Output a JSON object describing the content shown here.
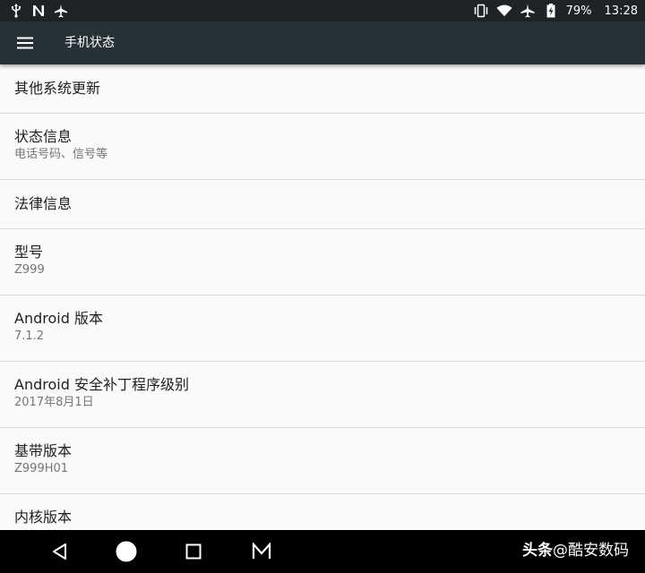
{
  "status_bar": {
    "left_icons": [
      "usb-icon",
      "n-notification-icon",
      "airplane-small-icon"
    ],
    "right_icons": [
      "vibrate-icon",
      "wifi-icon",
      "airplane-mode-icon",
      "battery-charging-icon"
    ],
    "battery": "79%",
    "time": "13:28"
  },
  "app_bar": {
    "menu_icon": "hamburger-menu-icon",
    "title": "手机状态"
  },
  "items": [
    {
      "title": "其他系统更新",
      "summary": ""
    },
    {
      "title": "状态信息",
      "summary": "电话号码、信号等"
    },
    {
      "title": "法律信息",
      "summary": ""
    },
    {
      "title": "型号",
      "summary": "Z999"
    },
    {
      "title": "Android 版本",
      "summary": "7.1.2"
    },
    {
      "title": "Android 安全补丁程序级别",
      "summary": "2017年8月1日"
    },
    {
      "title": "基带版本",
      "summary": "Z999H01"
    },
    {
      "title": "内核版本",
      "summary": ""
    }
  ],
  "nav_bar": {
    "buttons": [
      "back-icon",
      "home-icon",
      "recents-icon",
      "menu-m-icon"
    ]
  },
  "watermark": {
    "brand": "头条",
    "handle": "@酷安数码"
  },
  "colors": {
    "status_bar_bg": "#1d2327",
    "app_bar_bg": "#263238",
    "list_bg": "#fafafa",
    "divider": "#dcdcdc",
    "title_text": "#212121",
    "summary_text": "#757575"
  }
}
